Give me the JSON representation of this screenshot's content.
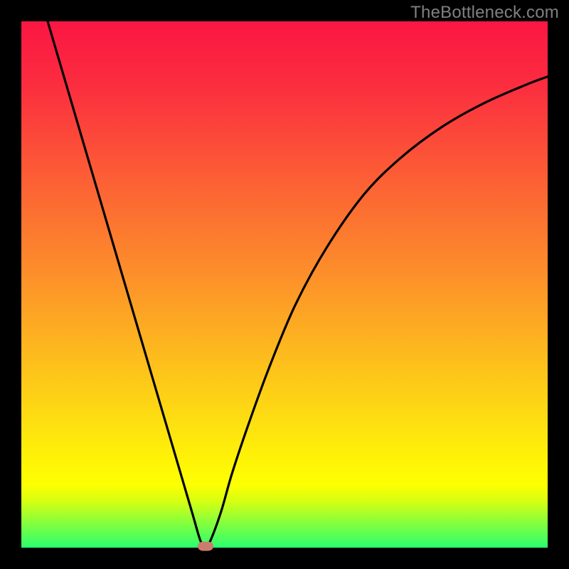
{
  "watermark": "TheBottleneck.com",
  "colors": {
    "frame": "#000000",
    "gradient_top": "#fb1643",
    "gradient_bottom": "#2aff6f",
    "curve": "#000000",
    "marker": "#cc7c6f",
    "watermark_text": "#808080"
  },
  "chart_data": {
    "type": "line",
    "title": "",
    "xlabel": "",
    "ylabel": "",
    "xlim": [
      0,
      100
    ],
    "ylim": [
      0,
      100
    ],
    "grid": false,
    "series": [
      {
        "name": "curve",
        "points_xy": [
          [
            5,
            100
          ],
          [
            10,
            83
          ],
          [
            15,
            66
          ],
          [
            20,
            49
          ],
          [
            25,
            32
          ],
          [
            30,
            15
          ],
          [
            32.5,
            6.5
          ],
          [
            34,
            1.4
          ],
          [
            35,
            0
          ],
          [
            36,
            1.5
          ],
          [
            38,
            7
          ],
          [
            40,
            14
          ],
          [
            43,
            23
          ],
          [
            47,
            34
          ],
          [
            52,
            46
          ],
          [
            58,
            57
          ],
          [
            65,
            67
          ],
          [
            72,
            74
          ],
          [
            80,
            80
          ],
          [
            88,
            84.5
          ],
          [
            96,
            88
          ],
          [
            100,
            89.5
          ]
        ]
      }
    ],
    "annotations": [
      {
        "name": "minimum-marker",
        "x": 35,
        "y": 0
      }
    ],
    "background_gradient": {
      "orientation": "vertical",
      "stops": [
        {
          "pos": 0,
          "color": "#fb1643"
        },
        {
          "pos": 30,
          "color": "#fc5f35"
        },
        {
          "pos": 62,
          "color": "#fdb71f"
        },
        {
          "pos": 88,
          "color": "#feff02"
        },
        {
          "pos": 100,
          "color": "#2aff6f"
        }
      ]
    }
  }
}
